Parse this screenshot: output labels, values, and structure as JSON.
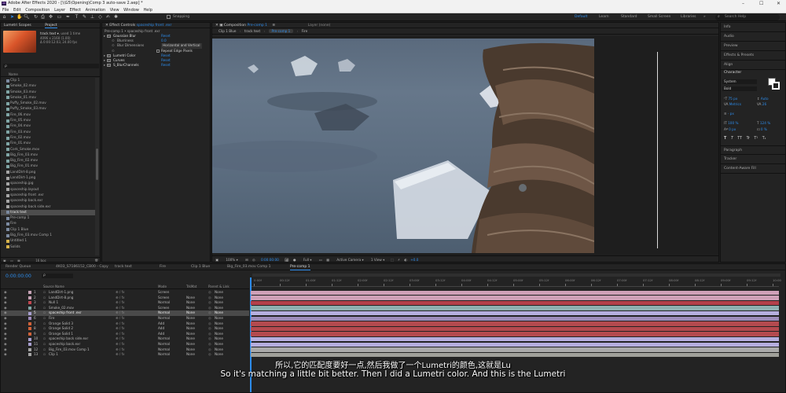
{
  "app": {
    "title": "Adobe After Effects 2020 - [\\\\G5\\Opening\\Comp 3 auto-save 2.aep] *",
    "menu": [
      "File",
      "Edit",
      "Composition",
      "Layer",
      "Effect",
      "Animation",
      "View",
      "Window",
      "Help"
    ]
  },
  "toolbar": {
    "snapping": "Snapping",
    "workspaces": [
      {
        "label": "Default",
        "active": true
      },
      {
        "label": "Learn"
      },
      {
        "label": "Standard"
      },
      {
        "label": "Small Screen"
      },
      {
        "label": "Libraries"
      }
    ],
    "search_placeholder": "Search Help"
  },
  "project": {
    "tabs": [
      "Lumetri Scopes",
      "Project"
    ],
    "selected_name": "track text",
    "selected_meta1": "4096 x 2160 (1.00)",
    "selected_meta2": "Δ 0:00:12:03, 24.00 fps",
    "selected_used": ", used 1 time",
    "search_placeholder": "ρ",
    "column_name": "Name",
    "items": [
      {
        "name": "Clip 1",
        "color": "#7b8aa0"
      },
      {
        "name": "Smoke_02.mov",
        "color": "#7fa5a5"
      },
      {
        "name": "Smoke_03.mov",
        "color": "#7fa5a5"
      },
      {
        "name": "Smoke_01.mov",
        "color": "#7fa5a5"
      },
      {
        "name": "Puffy_Smoke_02.mov",
        "color": "#7fa5a5"
      },
      {
        "name": "Puffy_Smoke_03.mov",
        "color": "#7fa5a5"
      },
      {
        "name": "Fire_06.mov",
        "color": "#7fa5a5"
      },
      {
        "name": "Fire_05.mov",
        "color": "#7fa5a5"
      },
      {
        "name": "Fire_04.mov",
        "color": "#7fa5a5"
      },
      {
        "name": "Fire_03.mov",
        "color": "#7fa5a5"
      },
      {
        "name": "Fire_02.mov",
        "color": "#7fa5a5"
      },
      {
        "name": "Fire_01.mov",
        "color": "#7fa5a5"
      },
      {
        "name": "Cork_Smoke.mov",
        "color": "#7fa5a5"
      },
      {
        "name": "Big_Fire_03.mov",
        "color": "#7fa5a5"
      },
      {
        "name": "Big_Fire_02.mov",
        "color": "#7fa5a5"
      },
      {
        "name": "Big_Fire_01.mov",
        "color": "#7fa5a5"
      },
      {
        "name": "LandDirt-8.png",
        "color": "#a5a5a5"
      },
      {
        "name": "LandDirt-1.png",
        "color": "#a5a5a5"
      },
      {
        "name": "spaceship.jpg",
        "color": "#a5a5a5"
      },
      {
        "name": "spaceship.layout",
        "color": "#a5a5a5"
      },
      {
        "name": "spaceship front .exr",
        "color": "#a5a5a5"
      },
      {
        "name": "spaceship back.exr",
        "color": "#a5a5a5"
      },
      {
        "name": "spaceship back side.exr",
        "color": "#a5a5a5"
      },
      {
        "name": "track text",
        "color": "#7b8aa0",
        "selected": true
      },
      {
        "name": "Pre-comp 1",
        "color": "#7b8aa0"
      },
      {
        "name": "Fire",
        "color": "#7b8aa0"
      },
      {
        "name": "Clip 1 Blue",
        "color": "#7b8aa0"
      },
      {
        "name": "Big_Fire_03.mov Comp 1",
        "color": "#7b8aa0"
      },
      {
        "name": "Untitled 1",
        "color": "#d6b24a"
      },
      {
        "name": "Solids",
        "color": "#d6b24a"
      }
    ],
    "footer_bpc": "16 bpc"
  },
  "effect_controls": {
    "tab_prefix": "Effect Controls",
    "tab_layer": "spaceship front .exr",
    "breadcrumb": "Pre-comp 1 • spaceship front .exr",
    "rows": [
      {
        "label": "Gaussian Blur",
        "value": "Reset",
        "indent": 0,
        "fx": true
      },
      {
        "label": "Blurriness",
        "value": "0.0",
        "indent": 1
      },
      {
        "label": "Blur Dimensions",
        "value": "Horizontal and Vertical",
        "indent": 1,
        "gray": true
      },
      {
        "label": "",
        "value": "Repeat Edge Pixels",
        "indent": 1,
        "check": true
      },
      {
        "label": "Lumetri Color",
        "value": "Reset",
        "indent": 0,
        "fx": true
      },
      {
        "label": "Curves",
        "value": "Reset",
        "indent": 0,
        "fx": true
      },
      {
        "label": "S_BlurChannels",
        "value": "Reset",
        "indent": 0,
        "fx": true
      }
    ]
  },
  "composition": {
    "tab_prefix": "Composition",
    "tab_name": "Pre-comp 1",
    "layer_tab": "Layer (none)",
    "subtabs": [
      "Clip 1 Blue",
      "track text",
      "Pre-comp 1",
      "Fire"
    ],
    "active_subtab": "Pre-comp 1",
    "footer": {
      "zoom": "100%",
      "time": "0:00:00:00",
      "resolution": "Full",
      "camera": "Active Camera",
      "views": "1 View",
      "exposure": "+0.0"
    }
  },
  "right_panel": {
    "items": [
      "Info",
      "Audio",
      "Preview",
      "Effects & Presets",
      "Align"
    ],
    "character": {
      "title": "Character",
      "font": "System",
      "style": "Bold",
      "size": "75 px",
      "leading": "Auto",
      "kerning": "Metrics",
      "tracking": "26",
      "stroke": "- px",
      "vscale": "100 %",
      "hscale": "124 %",
      "baseline": "0 px",
      "tsume": "0 %",
      "styles": [
        "T",
        "T",
        "TT",
        "Tr",
        "T¹",
        "T₁"
      ]
    },
    "bottom": [
      "Paragraph",
      "Tracker",
      "Content-Aware Fill"
    ]
  },
  "timeline": {
    "tabs": [
      {
        "label": "Render Queue"
      },
      {
        "label": "4K03_S7186152_CB00 - Copy"
      },
      {
        "label": "track text"
      },
      {
        "label": "Fire"
      },
      {
        "label": "Clip 1 Blue"
      },
      {
        "label": "Big_Fire_03.mov Comp 1"
      },
      {
        "label": "Pre-comp 1",
        "active": true
      }
    ],
    "timecode": "0:00:00:00",
    "search_placeholder": "ρ",
    "col_source": "Source Name",
    "col_mode": "Mode",
    "col_trkmat": "TrkMat",
    "col_parent": "Parent & Link",
    "ruler": [
      "0:00f",
      "00:12f",
      "01:00f",
      "01:12f",
      "02:00f",
      "02:12f",
      "03:00f",
      "03:12f",
      "04:00f",
      "04:12f",
      "05:00f",
      "05:12f",
      "06:00f",
      "06:12f",
      "07:00f",
      "07:12f",
      "08:00f",
      "08:12f",
      "09:00f",
      "09:12f",
      "10:00"
    ],
    "layers": [
      {
        "num": "1",
        "name": "LandDirt-1.png",
        "mode": "Screen",
        "trk": "",
        "parent": "None",
        "color": "#c7a3b6",
        "bar": "#cfa0b8"
      },
      {
        "num": "2",
        "name": "LandDirt-8.png",
        "mode": "Screen",
        "trk": "None",
        "parent": "None",
        "color": "#c7a3b6",
        "bar": "#cfa0b8"
      },
      {
        "num": "3",
        "name": "Null 1",
        "mode": "Normal",
        "trk": "None",
        "parent": "None",
        "color": "#c24650",
        "bar": "#b4404a"
      },
      {
        "num": "4",
        "name": "Smoke_02.mov",
        "mode": "Screen",
        "trk": "None",
        "parent": "None",
        "color": "#7fa5a5",
        "bar": "#8fb0b0"
      },
      {
        "num": "5",
        "name": "spaceship front .exr",
        "mode": "Normal",
        "trk": "None",
        "parent": "None",
        "color": "#a8a0d0",
        "bar": "#b5aede",
        "selected": true
      },
      {
        "num": "6",
        "name": "Fire",
        "mode": "Normal",
        "trk": "None",
        "parent": "None",
        "color": "#9f8bbd",
        "bar": "#9c8cba"
      },
      {
        "num": "7",
        "name": "Orange Solid 3",
        "mode": "Add",
        "trk": "None",
        "parent": "None",
        "color": "#d0623a",
        "bar": "#b44a4f"
      },
      {
        "num": "8",
        "name": "Orange Solid 2",
        "mode": "Add",
        "trk": "None",
        "parent": "None",
        "color": "#d0623a",
        "bar": "#b44a4f"
      },
      {
        "num": "9",
        "name": "Orange Solid 1",
        "mode": "Add",
        "trk": "None",
        "parent": "None",
        "color": "#d0623a",
        "bar": "#b44a4f"
      },
      {
        "num": "10",
        "name": "spaceship back side.exr",
        "mode": "Normal",
        "trk": "None",
        "parent": "None",
        "color": "#a8a0d0",
        "bar": "#b5aede"
      },
      {
        "num": "11",
        "name": "spaceship back.exr",
        "mode": "Normal",
        "trk": "None",
        "parent": "None",
        "color": "#a8a0d0",
        "bar": "#b5aede"
      },
      {
        "num": "12",
        "name": "Big_Fire_03.mov Comp 1",
        "mode": "Normal",
        "trk": "None",
        "parent": "None",
        "color": "#a5a5a5",
        "bar": "#aaaaaa"
      },
      {
        "num": "13",
        "name": "Clip 1",
        "mode": "Normal",
        "trk": "None",
        "parent": "None",
        "color": "#a5a5a5",
        "bar": "#a0a09a"
      }
    ]
  },
  "subtitle": {
    "zh": "所以,它的匹配度要好一点,然后我做了一个Lumetri的颜色,这就是Lu",
    "en": "So it's matching a little bit better. Then I did a Lumetri color. And this is the Lumetri"
  }
}
